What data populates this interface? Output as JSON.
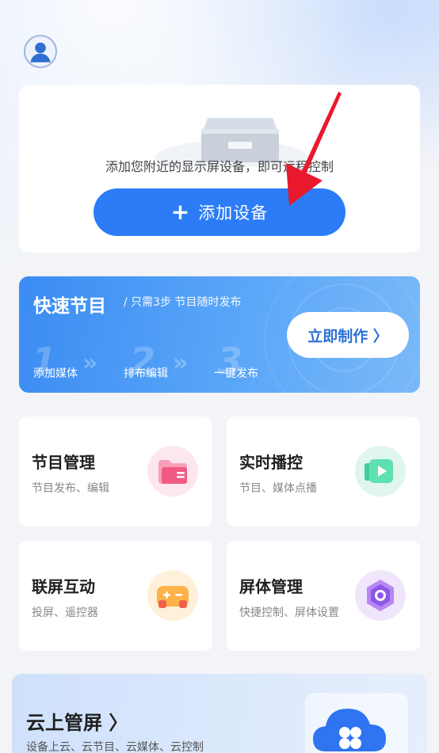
{
  "add_device": {
    "hint": "添加您附近的显示屏设备，即可远程控制",
    "button_label": "添加设备",
    "button_icon": "plus-icon"
  },
  "quick_program": {
    "title": "快速节目",
    "subtitle": "/ 只需3步 节目随时发布",
    "button_label": "立即制作 〉",
    "steps": [
      {
        "num": "1",
        "label": "添加媒体"
      },
      {
        "num": "2",
        "label": "排布编辑"
      },
      {
        "num": "3",
        "label": "一键发布"
      }
    ]
  },
  "tiles": [
    {
      "title": "节目管理",
      "subtitle": "节目发布、编辑",
      "icon": "folder-icon"
    },
    {
      "title": "实时播控",
      "subtitle": "节目、媒体点播",
      "icon": "play-icon"
    },
    {
      "title": "联屏互动",
      "subtitle": "投屏、遥控器",
      "icon": "gamepad-icon"
    },
    {
      "title": "屏体管理",
      "subtitle": "快捷控制、屏体设置",
      "icon": "hexagon-nut-icon"
    }
  ],
  "cloud": {
    "title": "云上管屏 〉",
    "subtitle": "设备上云、云节目、云媒体、云控制",
    "icon": "cloud-icon"
  },
  "colors": {
    "primary": "#2b7cf6",
    "quick_gradient_start": "#3b8cf3",
    "annotation_arrow": "#e8192c"
  }
}
